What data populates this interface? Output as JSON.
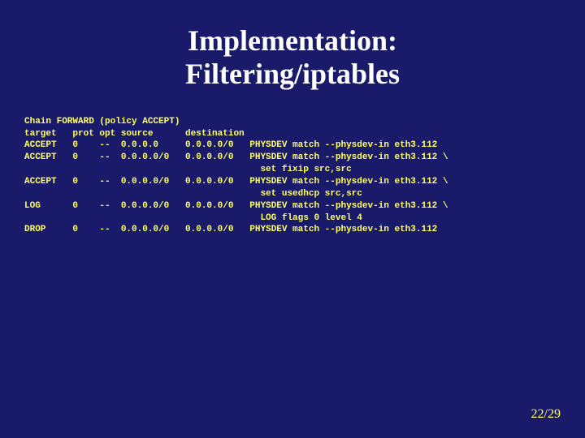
{
  "title_line1": "Implementation:",
  "title_line2": "Filtering/iptables",
  "code": "Chain FORWARD (policy ACCEPT)\ntarget   prot opt source      destination\nACCEPT   0    --  0.0.0.0     0.0.0.0/0   PHYSDEV match --physdev-in eth3.112\nACCEPT   0    --  0.0.0.0/0   0.0.0.0/0   PHYSDEV match --physdev-in eth3.112 \\\n                                            set fixip src,src\nACCEPT   0    --  0.0.0.0/0   0.0.0.0/0   PHYSDEV match --physdev-in eth3.112 \\\n                                            set usedhcp src,src\nLOG      0    --  0.0.0.0/0   0.0.0.0/0   PHYSDEV match --physdev-in eth3.112 \\\n                                            LOG flags 0 level 4\nDROP     0    --  0.0.0.0/0   0.0.0.0/0   PHYSDEV match --physdev-in eth3.112",
  "page_number": "22/29"
}
